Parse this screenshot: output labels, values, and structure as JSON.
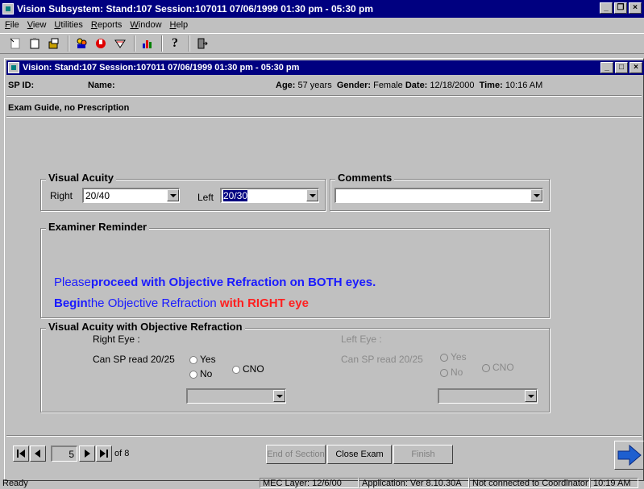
{
  "app": {
    "title": "Vision Subsystem: Stand:107 Session:107011 07/06/1999 01:30 pm - 05:30 pm",
    "menu": [
      "File",
      "View",
      "Utilities",
      "Reports",
      "Window",
      "Help"
    ]
  },
  "toolbar": {
    "icons": [
      "new-record-icon",
      "clipboard-icon",
      "open-icon",
      "people-icon",
      "stop-icon",
      "flag-icon",
      "chart-icon",
      "help-icon",
      "exit-icon"
    ]
  },
  "child_window": {
    "title": "Vision: Stand:107 Session:107011 07/06/1999 01:30 pm - 05:30 pm"
  },
  "patient": {
    "sp_id_label": "SP ID:",
    "name_label": "Name:",
    "age_label": "Age:",
    "age_value": "57 years",
    "gender_label": "Gender:",
    "gender_value": "Female",
    "date_label": "Date:",
    "date_value": "12/18/2000",
    "time_label": "Time:",
    "time_value": "10:16 AM"
  },
  "section_title": "Exam Guide, no Prescription",
  "visual_acuity": {
    "legend": "Visual Acuity",
    "right_label": "Right",
    "right_value": "20/40",
    "left_label": "Left",
    "left_value": "20/30"
  },
  "comments": {
    "legend": "Comments",
    "value": ""
  },
  "reminder": {
    "legend": "Examiner Reminder",
    "line1_a": "Please",
    "line1_b": "proceed with Objective Refraction on BOTH eyes.",
    "line2_a": "Begin",
    "line2_b": "the Objective Refraction",
    "line2_c": "with RIGHT eye",
    "colors": {
      "blue": "#1a1aff",
      "red": "#ff2020"
    }
  },
  "objective": {
    "legend": "Visual Acuity with Objective Refraction",
    "right_eye_label": "Right Eye :",
    "left_eye_label": "Left Eye :",
    "question": "Can SP read 20/25",
    "yes": "Yes",
    "no": "No",
    "cno": "CNO"
  },
  "nav": {
    "page": "5",
    "of": "of 8",
    "end_of_section": "End of Section",
    "close_exam": "Close Exam",
    "finish": "Finish"
  },
  "status": {
    "ready": "Ready",
    "mec_layer": "MEC Layer: 12/6/00",
    "application": "Application: Ver 8.10.30A",
    "coordinator": "Not connected to Coordinator",
    "clock": "10:19 AM"
  }
}
